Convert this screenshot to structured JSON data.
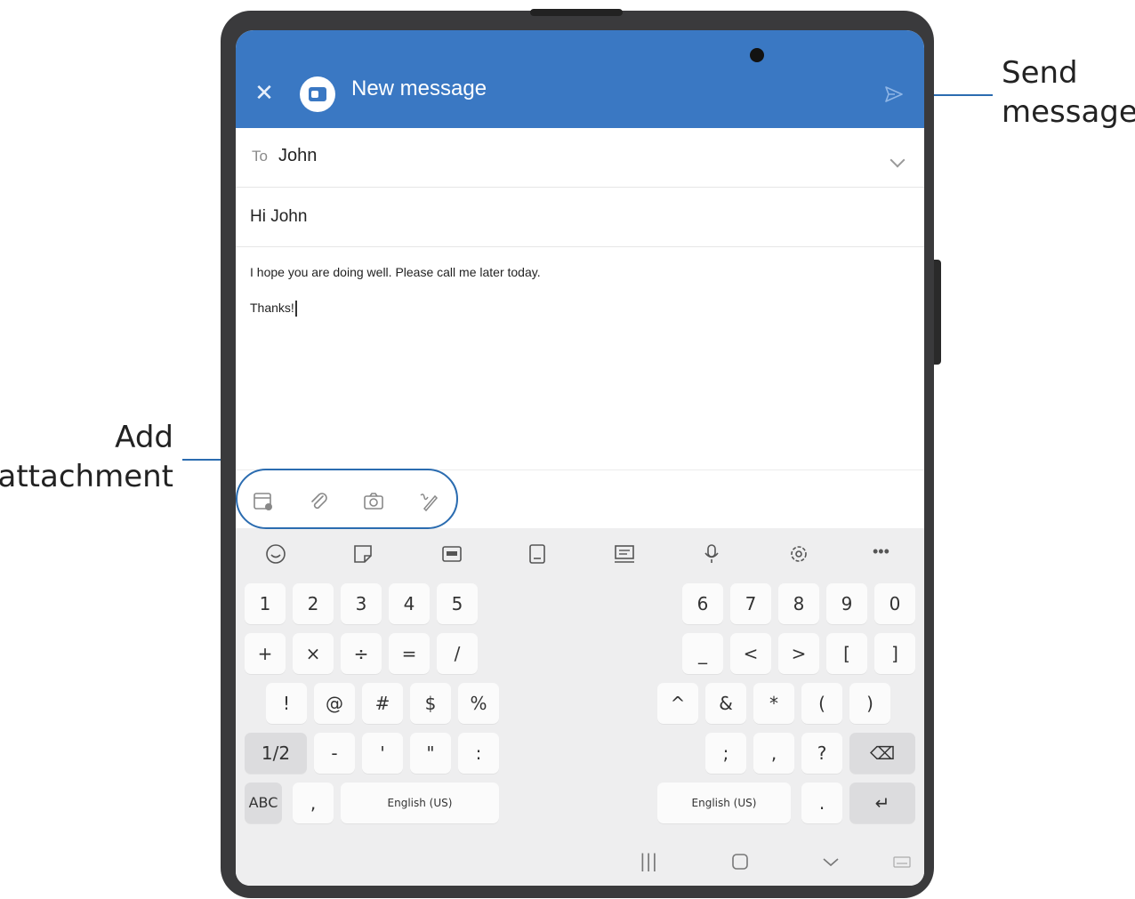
{
  "annotations": {
    "send_message": "Send\nmessage",
    "add_attachment": "Add\nattachment"
  },
  "header": {
    "title": "New message",
    "close_icon": "close-icon",
    "send_icon": "send-icon"
  },
  "compose": {
    "to_label": "To",
    "to_value": "John",
    "subject": "Hi John",
    "body_line1": "I hope you are doing well. Please call me later today.",
    "body_line2": "Thanks!"
  },
  "toolbar": {
    "icons": [
      "calendar-attach-icon",
      "paperclip-icon",
      "camera-icon",
      "signature-pen-icon"
    ]
  },
  "keyboard": {
    "top_icons": [
      "emoji-icon",
      "sticker-icon",
      "gif-icon",
      "clipboard-icon",
      "screen-text-icon",
      "mic-icon",
      "settings-icon"
    ],
    "more": "•••",
    "left": {
      "row1": [
        "1",
        "2",
        "3",
        "4",
        "5"
      ],
      "row2": [
        "+",
        "×",
        "÷",
        "=",
        "/"
      ],
      "row3": [
        "!",
        "@",
        "#",
        "$",
        "%"
      ],
      "row4": [
        "1/2",
        "-",
        "'",
        "\"",
        ":"
      ],
      "row5": [
        "ABC",
        ",",
        "English (US)"
      ]
    },
    "right": {
      "row1": [
        "6",
        "7",
        "8",
        "9",
        "0"
      ],
      "row2": [
        "_",
        "<",
        ">",
        "[",
        "]"
      ],
      "row3": [
        "^",
        "&",
        "*",
        "(",
        ")"
      ],
      "row4": [
        ";",
        ",",
        "?",
        "⌫"
      ],
      "row5": [
        "English (US)",
        ".",
        "↵"
      ]
    }
  },
  "nav": {
    "recents": "|||",
    "home": "home-icon",
    "back": "back-chevron-icon",
    "keyboard": "keyboard-icon"
  },
  "colors": {
    "header_bg": "#3a78c3",
    "accent": "#2b6cb0",
    "keyboard_bg": "#eeeeef"
  }
}
